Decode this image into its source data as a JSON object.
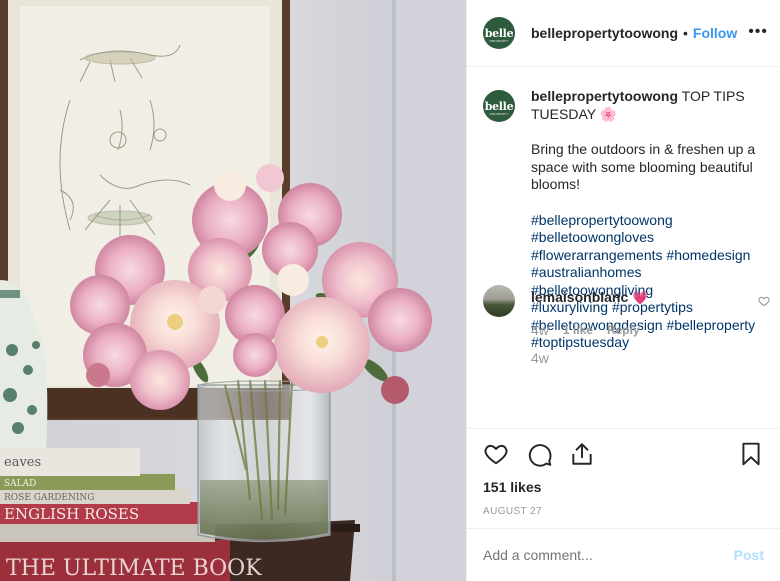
{
  "post": {
    "username": "bellepropertytoowong",
    "avatar_text": "belle",
    "avatar_subtext": "PROPERTY",
    "follow_label": "Follow",
    "dot": "•",
    "more_label": "•••"
  },
  "caption": {
    "username": "bellepropertytoowong",
    "title": "TOP TIPS TUESDAY",
    "title_emoji": "🌸",
    "body": "Bring the outdoors in & freshen up a space with some blooming beautiful blooms!",
    "hashtags": [
      "#bellepropertytoowong",
      "#belletoowongloves",
      "#flowerarrangements",
      "#homedesign",
      "#australianhomes",
      "#belletoowongliving",
      "#luxuryliving",
      "#propertytips",
      "#belletoowongdesign",
      "#belleproperty",
      "#toptipstuesday"
    ],
    "time": "4w"
  },
  "comment": {
    "username": "lemaisonblanc",
    "emoji": "💗",
    "time": "4w",
    "likes_label": "1 like",
    "reply_label": "Reply"
  },
  "stats": {
    "likes": "151 likes",
    "date": "AUGUST 27"
  },
  "add_comment": {
    "placeholder": "Add a comment...",
    "post_label": "Post"
  },
  "colors": {
    "link": "#3897f0",
    "hashtag": "#003569",
    "brand_green": "#2e5a3e",
    "muted": "#999999",
    "post_disabled": "#b2dffc"
  }
}
